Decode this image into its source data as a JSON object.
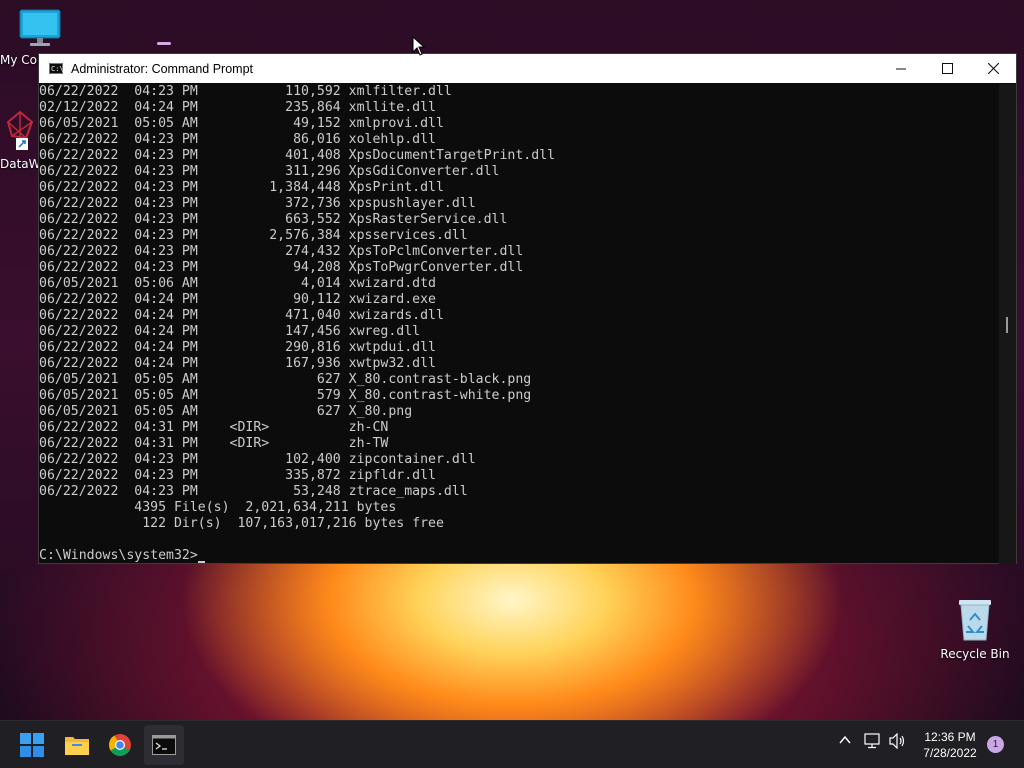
{
  "desktop": {
    "icons": [
      {
        "label": "My Computer",
        "icon": "monitor-icon"
      },
      {
        "label": "DataWizard",
        "icon": "datawizard-shortcut-icon"
      },
      {
        "label": "Recycle Bin",
        "icon": "recycle-bin-icon"
      }
    ]
  },
  "window": {
    "title": "Administrator: Command Prompt",
    "icon": "cmd-icon",
    "icon_text": "C:\\",
    "controls": [
      "minimize-icon",
      "maximize-icon",
      "close-icon"
    ],
    "console_lines": [
      "06/22/2022  04:23 PM           110,592 xmlfilter.dll",
      "02/12/2022  04:24 PM           235,864 xmllite.dll",
      "06/05/2021  05:05 AM            49,152 xmlprovi.dll",
      "06/22/2022  04:23 PM            86,016 xolehlp.dll",
      "06/22/2022  04:23 PM           401,408 XpsDocumentTargetPrint.dll",
      "06/22/2022  04:23 PM           311,296 XpsGdiConverter.dll",
      "06/22/2022  04:23 PM         1,384,448 XpsPrint.dll",
      "06/22/2022  04:23 PM           372,736 xpspushlayer.dll",
      "06/22/2022  04:23 PM           663,552 XpsRasterService.dll",
      "06/22/2022  04:23 PM         2,576,384 xpsservices.dll",
      "06/22/2022  04:23 PM           274,432 XpsToPclmConverter.dll",
      "06/22/2022  04:23 PM            94,208 XpsToPwgrConverter.dll",
      "06/05/2021  05:06 AM             4,014 xwizard.dtd",
      "06/22/2022  04:24 PM            90,112 xwizard.exe",
      "06/22/2022  04:24 PM           471,040 xwizards.dll",
      "06/22/2022  04:24 PM           147,456 xwreg.dll",
      "06/22/2022  04:24 PM           290,816 xwtpdui.dll",
      "06/22/2022  04:24 PM           167,936 xwtpw32.dll",
      "06/05/2021  05:05 AM               627 X_80.contrast-black.png",
      "06/05/2021  05:05 AM               579 X_80.contrast-white.png",
      "06/05/2021  05:05 AM               627 X_80.png",
      "06/22/2022  04:31 PM    <DIR>          zh-CN",
      "06/22/2022  04:31 PM    <DIR>          zh-TW",
      "06/22/2022  04:23 PM           102,400 zipcontainer.dll",
      "06/22/2022  04:23 PM           335,872 zipfldr.dll",
      "06/22/2022  04:23 PM            53,248 ztrace_maps.dll",
      "            4395 File(s)  2,021,634,211 bytes",
      "             122 Dir(s)  107,163,017,216 bytes free",
      ""
    ],
    "prompt": "C:\\Windows\\system32>"
  },
  "taskbar": {
    "apps": [
      "windows-start-icon",
      "file-explorer-icon",
      "chrome-icon",
      "command-prompt-icon"
    ],
    "tray_icons": [
      "chevron-up-icon",
      "network-icon",
      "volume-icon"
    ],
    "time": "12:36 PM",
    "date": "7/28/2022",
    "notification_count": "1"
  }
}
